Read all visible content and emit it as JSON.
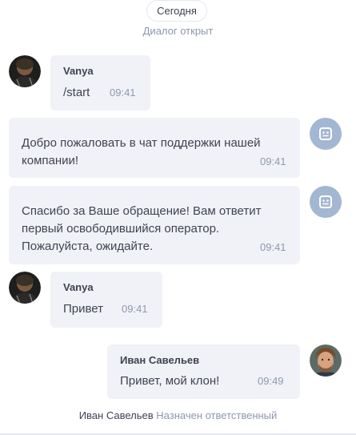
{
  "date_divider": "Сегодня",
  "dialog_opened": "Диалог открыт",
  "messages": [
    {
      "sender": "Vanya",
      "text": "/start",
      "time": "09:41"
    },
    {
      "text": "Добро пожаловать в чат поддержки нашей компании!",
      "time": "09:41"
    },
    {
      "text": "Спасибо за Ваше обращение! Вам ответит первый освободившийся оператор. Пожалуйста, ожидайте.",
      "time": "09:41"
    },
    {
      "sender": "Vanya",
      "text": "Привет",
      "time": "09:41"
    },
    {
      "sender": "Иван Савельев",
      "text": "Привет, мой клон!",
      "time": "09:49"
    }
  ],
  "assignment": {
    "name": "Иван Савельев",
    "action": "Назначен ответственный"
  },
  "colors": {
    "bubble": "#f1f2f7",
    "muted_text": "#8e97ad",
    "bot_avatar": "#a3b7d3"
  }
}
